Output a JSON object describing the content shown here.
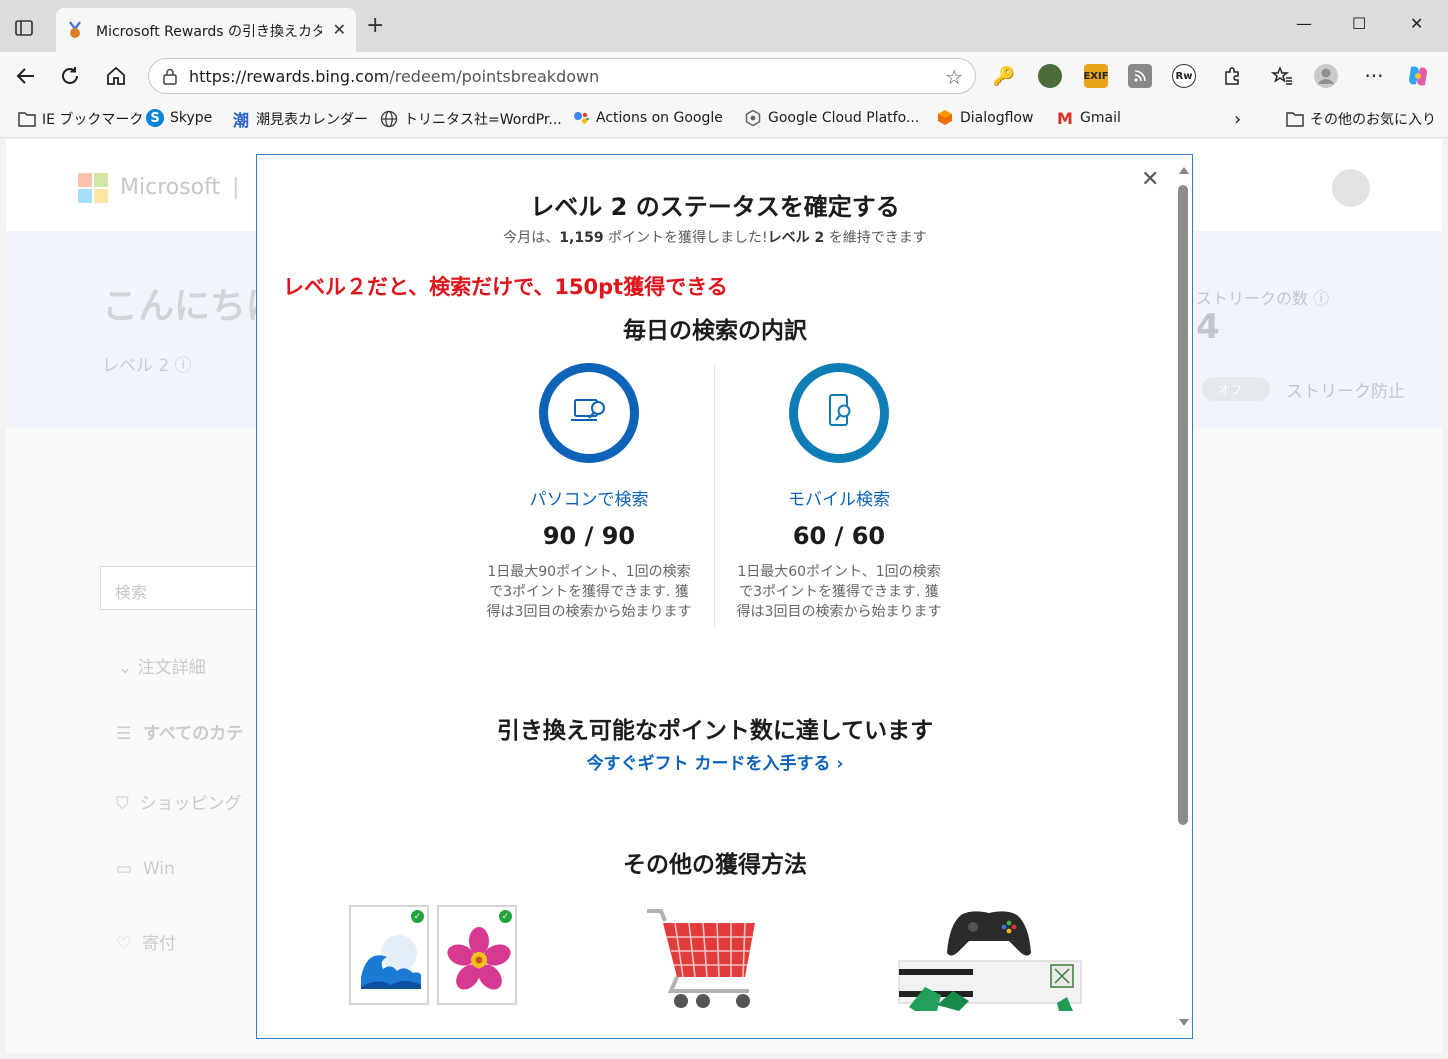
{
  "browser": {
    "tab_title": "Microsoft Rewards の引き換えカタロ",
    "tab_close": "✕",
    "new_tab": "+",
    "window_controls": {
      "minimize": "—",
      "maximize": "☐",
      "close": "✕"
    },
    "url_host": "https://rewards.bing.com",
    "url_path": "/redeem/pointsbreakdown",
    "icons": [
      "sidebar-icon",
      "back-icon",
      "refresh-icon",
      "home-icon",
      "lock-icon",
      "star-icon",
      "extension-icon",
      "favorites-icon",
      "profile-icon",
      "more-icon",
      "copilot-icon"
    ],
    "extensions": {
      "exif": "EXIF",
      "rw": "Rw"
    }
  },
  "bookmarks": [
    {
      "label": "IE ブックマーク",
      "icon": "folder-icon"
    },
    {
      "label": "Skype",
      "icon": "skype-icon"
    },
    {
      "label": "潮見表カレンダー",
      "icon": "tide-icon",
      "glyph": "潮"
    },
    {
      "label": "トリニタス社=WordPr...",
      "icon": "globe-icon"
    },
    {
      "label": "Actions on Google",
      "icon": "google-assistant-icon"
    },
    {
      "label": "Google Cloud Platfo...",
      "icon": "gcp-icon"
    },
    {
      "label": "Dialogflow",
      "icon": "dialogflow-icon"
    },
    {
      "label": "Gmail",
      "icon": "gmail-icon",
      "glyph": "M"
    },
    {
      "label": "その他のお気に入り",
      "icon": "folder-icon"
    }
  ],
  "background_page": {
    "brand": "Microsoft",
    "separator": "|",
    "greeting": "こんにちは",
    "level": "レベル 2",
    "streak_title": "ストリークの数",
    "streak_value": "4",
    "streak_toggle": "オフ",
    "streak_protect": "ストリーク防止",
    "search_placeholder": "検索",
    "order_details": "注文詳細",
    "sidebar": [
      "すべてのカテ",
      "ショッピング",
      "Win",
      "寄付"
    ]
  },
  "modal": {
    "title": "レベル 2 のステータスを確定する",
    "subtitle_pre": "今月は、",
    "subtitle_points": "1,159",
    "subtitle_mid": " ポイントを獲得しました!",
    "subtitle_level": "レベル 2",
    "subtitle_post": " を維持できます",
    "annotation": "レベル２だと、検索だけで、150pt獲得できる",
    "daily_title": "毎日の検索の内訳",
    "pc": {
      "label": "パソコンで検索",
      "score": "90 / 90",
      "desc": "1日最大90ポイント、1回の検索で3ポイントを獲得できます. 獲得は3回目の検索から始まります"
    },
    "mobile": {
      "label": "モバイル検索",
      "score": "60 / 60",
      "desc": "1日最大60ポイント、1回の検索で3ポイントを獲得できます. 獲得は3回目の検索から始まります"
    },
    "redeem_title": "引き換え可能なポイント数に達しています",
    "redeem_link": "今すぐギフト カードを入手する",
    "redeem_chevron": "›",
    "other_title": "その他の獲得方法",
    "close": "✕"
  },
  "colors": {
    "accent": "#0b62b8",
    "annotation": "#e0141b",
    "check": "#21a33b"
  }
}
